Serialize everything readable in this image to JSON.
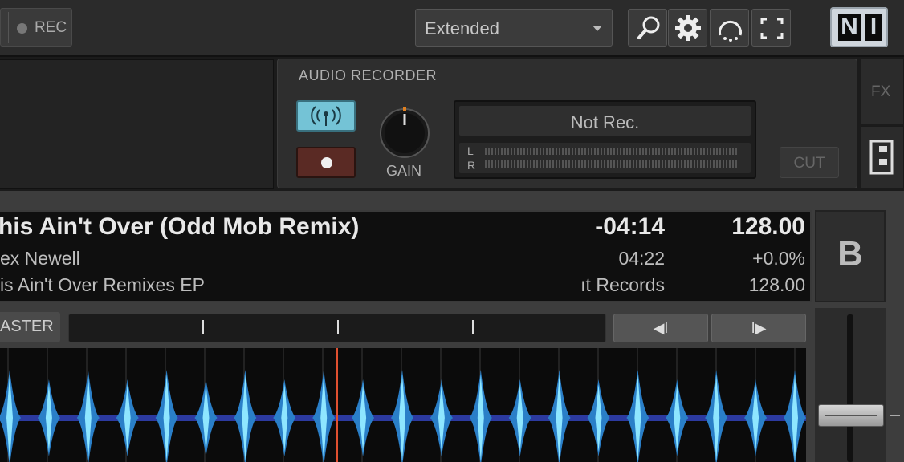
{
  "topbar": {
    "rec_label": "REC",
    "layout_select_value": "Extended",
    "tools": [
      "search-icon",
      "gear-icon",
      "loop-icon",
      "fullscreen-icon"
    ],
    "logo_text_n": "N",
    "logo_text_i": "I"
  },
  "recorder": {
    "title": "AUDIO  RECORDER",
    "gain_label": "GAIN",
    "status": "Not Rec.",
    "meter_left": "L",
    "meter_right": "R",
    "cut_label": "CUT",
    "broadcast_icon": "broadcast-icon",
    "record_icon": "record-icon"
  },
  "side_tabs": {
    "fx_label": "FX"
  },
  "deck": {
    "letter": "B",
    "title": "his Ain't Over (Odd Mob Remix)",
    "artist": "ex Newell",
    "album": "is Ain't Over Remixes EP",
    "time_remaining": "-04:14",
    "time_total": "04:22",
    "label": "ıt Records",
    "bpm": "128.00",
    "pitch": "+0.0%",
    "original_bpm": "128.00",
    "master_label": "ASTER",
    "jump_back_label": "◀I",
    "jump_fwd_label": "I▶"
  },
  "colors": {
    "accent": "#74c3d6",
    "record": "#5a2a24",
    "playhead": "#e05030",
    "waveform": "#3aa8d8"
  }
}
